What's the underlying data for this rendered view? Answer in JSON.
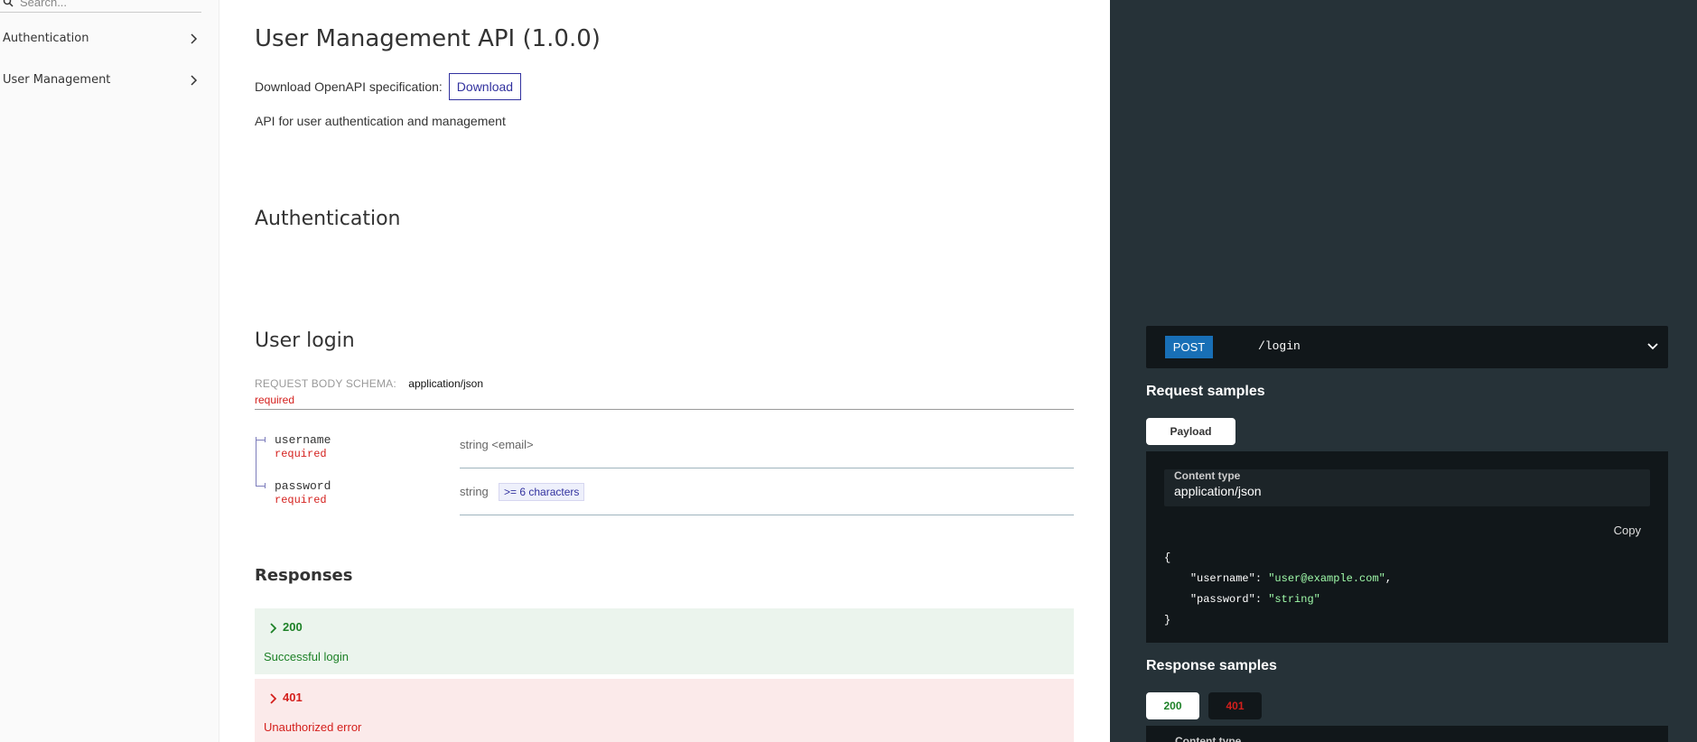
{
  "sidebar": {
    "search_placeholder": "Search...",
    "items": [
      {
        "label": "Authentication"
      },
      {
        "label": "User Management"
      }
    ]
  },
  "main": {
    "title": "User Management API (1.0.0)",
    "download_label": "Download OpenAPI specification:",
    "download_button": "Download",
    "description": "API for user authentication and management",
    "section_title": "Authentication",
    "operation_title": "User login",
    "request_body_label": "REQUEST BODY SCHEMA:",
    "request_body_type": "application/json",
    "request_body_required": "required",
    "properties": [
      {
        "name": "username",
        "required": "required",
        "type": "string <email>"
      },
      {
        "name": "password",
        "required": "required",
        "type": "string",
        "constraint": ">= 6 characters"
      }
    ],
    "responses_title": "Responses",
    "responses": [
      {
        "code": "200",
        "description": "Successful login"
      },
      {
        "code": "401",
        "description": "Unauthorized error"
      }
    ]
  },
  "right_panel": {
    "method": "POST",
    "path": "/login",
    "request_samples_title": "Request samples",
    "payload_tab": "Payload",
    "content_type_label": "Content type",
    "content_type_value": "application/json",
    "copy_label": "Copy",
    "code": {
      "open": "{",
      "username_key": "\"username\"",
      "username_value": "\"user@example.com\"",
      "password_key": "\"password\"",
      "password_value": "\"string\"",
      "close": "}"
    },
    "response_samples_title": "Response samples",
    "response_tabs": [
      "200",
      "401"
    ],
    "response_content_type_label": "Content type"
  },
  "colors": {
    "accent": "#32329f",
    "post_badge": "#186fb6",
    "success": "#1d8127",
    "error": "#d41f1c",
    "right_panel_bg": "#263238"
  }
}
